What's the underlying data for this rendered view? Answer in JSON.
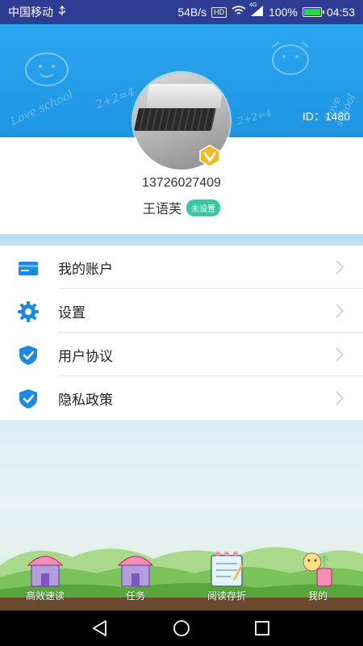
{
  "status_bar": {
    "carrier": "中国移动",
    "usb_icon": "usb-icon",
    "speed": "54B/s",
    "hd": "HD",
    "signal": "4G",
    "battery": "100%",
    "time": "04:53"
  },
  "header": {
    "id_label": "ID：1480",
    "doodle_text_1": "Love school",
    "doodle_text_2": "2+2=4",
    "doodle_text_3": "Love school"
  },
  "profile": {
    "phone": "13726027409",
    "name": "王语芙",
    "badge": "未设置"
  },
  "menu": [
    {
      "label": "我的账户",
      "icon": "card-icon"
    },
    {
      "label": "设置",
      "icon": "gear-icon"
    },
    {
      "label": "用户协议",
      "icon": "shield-check-icon"
    },
    {
      "label": "隐私政策",
      "icon": "shield-check-icon"
    }
  ],
  "tabs": [
    {
      "label": "高效速读",
      "icon": "house-icon"
    },
    {
      "label": "任务",
      "icon": "house-icon"
    },
    {
      "label": "阅读存折",
      "icon": "notebook-icon"
    },
    {
      "label": "我的",
      "icon": "cartoon-icon"
    }
  ],
  "colors": {
    "status_bar": "#2e3c93",
    "header": "#2aa6ee",
    "accent_blue": "#1e88e5",
    "badge_green": "#38c7a3"
  }
}
